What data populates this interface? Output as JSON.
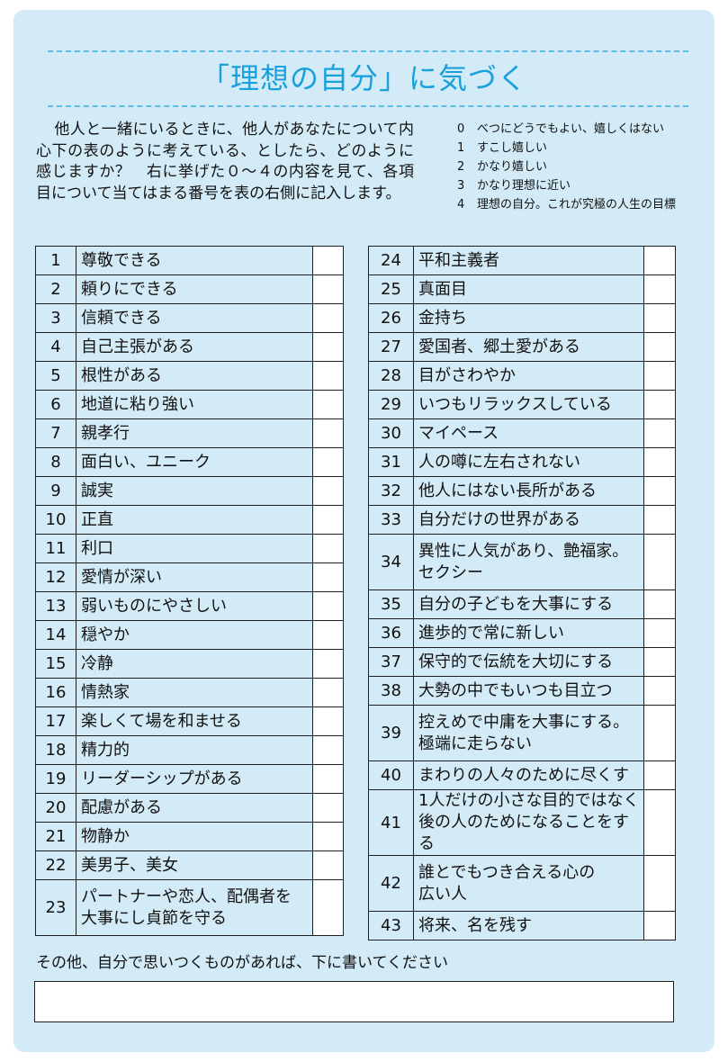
{
  "title": "「理想の自分」に気づく",
  "intro": "他人と一緒にいるときに、他人があなたについて内心下の表のように考えている、としたら、どのように感じますか？　右に挙げた０～４の内容を見て、各項目について当てはまる番号を表の右側に記入します。",
  "legend": [
    {
      "n": "0",
      "text": "べつにどうでもよい、嬉しくはない"
    },
    {
      "n": "1",
      "text": "すこし嬉しい"
    },
    {
      "n": "2",
      "text": "かなり嬉しい"
    },
    {
      "n": "3",
      "text": "かなり理想に近い"
    },
    {
      "n": "4",
      "text": "理想の自分。これが究極の人生の目標"
    }
  ],
  "left_table": [
    {
      "no": "1",
      "lines": [
        "尊敬できる"
      ]
    },
    {
      "no": "2",
      "lines": [
        "頼りにできる"
      ]
    },
    {
      "no": "3",
      "lines": [
        "信頼できる"
      ]
    },
    {
      "no": "4",
      "lines": [
        "自己主張がある"
      ]
    },
    {
      "no": "5",
      "lines": [
        "根性がある"
      ]
    },
    {
      "no": "6",
      "lines": [
        "地道に粘り強い"
      ]
    },
    {
      "no": "7",
      "lines": [
        "親孝行"
      ]
    },
    {
      "no": "8",
      "lines": [
        "面白い、ユニーク"
      ]
    },
    {
      "no": "9",
      "lines": [
        "誠実"
      ]
    },
    {
      "no": "10",
      "lines": [
        "正直"
      ]
    },
    {
      "no": "11",
      "lines": [
        "利口"
      ]
    },
    {
      "no": "12",
      "lines": [
        "愛情が深い"
      ]
    },
    {
      "no": "13",
      "lines": [
        "弱いものにやさしい"
      ]
    },
    {
      "no": "14",
      "lines": [
        "穏やか"
      ]
    },
    {
      "no": "15",
      "lines": [
        "冷静"
      ]
    },
    {
      "no": "16",
      "lines": [
        "情熱家"
      ]
    },
    {
      "no": "17",
      "lines": [
        "楽しくて場を和ませる"
      ]
    },
    {
      "no": "18",
      "lines": [
        "精力的"
      ]
    },
    {
      "no": "19",
      "lines": [
        "リーダーシップがある"
      ]
    },
    {
      "no": "20",
      "lines": [
        "配慮がある"
      ]
    },
    {
      "no": "21",
      "lines": [
        "物静か"
      ]
    },
    {
      "no": "22",
      "lines": [
        "美男子、美女"
      ]
    },
    {
      "no": "23",
      "lines": [
        "パートナーや恋人、配偶者を",
        "大事にし貞節を守る"
      ]
    }
  ],
  "right_table": [
    {
      "no": "24",
      "lines": [
        "平和主義者"
      ]
    },
    {
      "no": "25",
      "lines": [
        "真面目"
      ]
    },
    {
      "no": "26",
      "lines": [
        "金持ち"
      ]
    },
    {
      "no": "27",
      "lines": [
        "愛国者、郷土愛がある"
      ]
    },
    {
      "no": "28",
      "lines": [
        "目がさわやか"
      ]
    },
    {
      "no": "29",
      "lines": [
        "いつもリラックスしている"
      ]
    },
    {
      "no": "30",
      "lines": [
        "マイペース"
      ]
    },
    {
      "no": "31",
      "lines": [
        "人の噂に左右されない"
      ]
    },
    {
      "no": "32",
      "lines": [
        "他人にはない長所がある"
      ]
    },
    {
      "no": "33",
      "lines": [
        "自分だけの世界がある"
      ]
    },
    {
      "no": "34",
      "lines": [
        "異性に人気があり、艶福家。",
        "セクシー"
      ]
    },
    {
      "no": "35",
      "lines": [
        "自分の子どもを大事にする"
      ]
    },
    {
      "no": "36",
      "lines": [
        "進歩的で常に新しい"
      ]
    },
    {
      "no": "37",
      "lines": [
        "保守的で伝統を大切にする"
      ]
    },
    {
      "no": "38",
      "lines": [
        "大勢の中でもいつも目立つ"
      ]
    },
    {
      "no": "39",
      "lines": [
        "控えめで中庸を大事にする。",
        "極端に走らない"
      ]
    },
    {
      "no": "40",
      "lines": [
        "まわりの人々のために尽くす"
      ]
    },
    {
      "no": "41",
      "lines": [
        "1人だけの小さな目的ではなく",
        "後の人のためになることをする"
      ]
    },
    {
      "no": "42",
      "lines": [
        "誰とでもつき合える心の",
        "広い人"
      ]
    },
    {
      "no": "43",
      "lines": [
        "将来、名を残す"
      ]
    }
  ],
  "footer_note": "その他、自分で思いつくものがあれば、下に書いてください"
}
